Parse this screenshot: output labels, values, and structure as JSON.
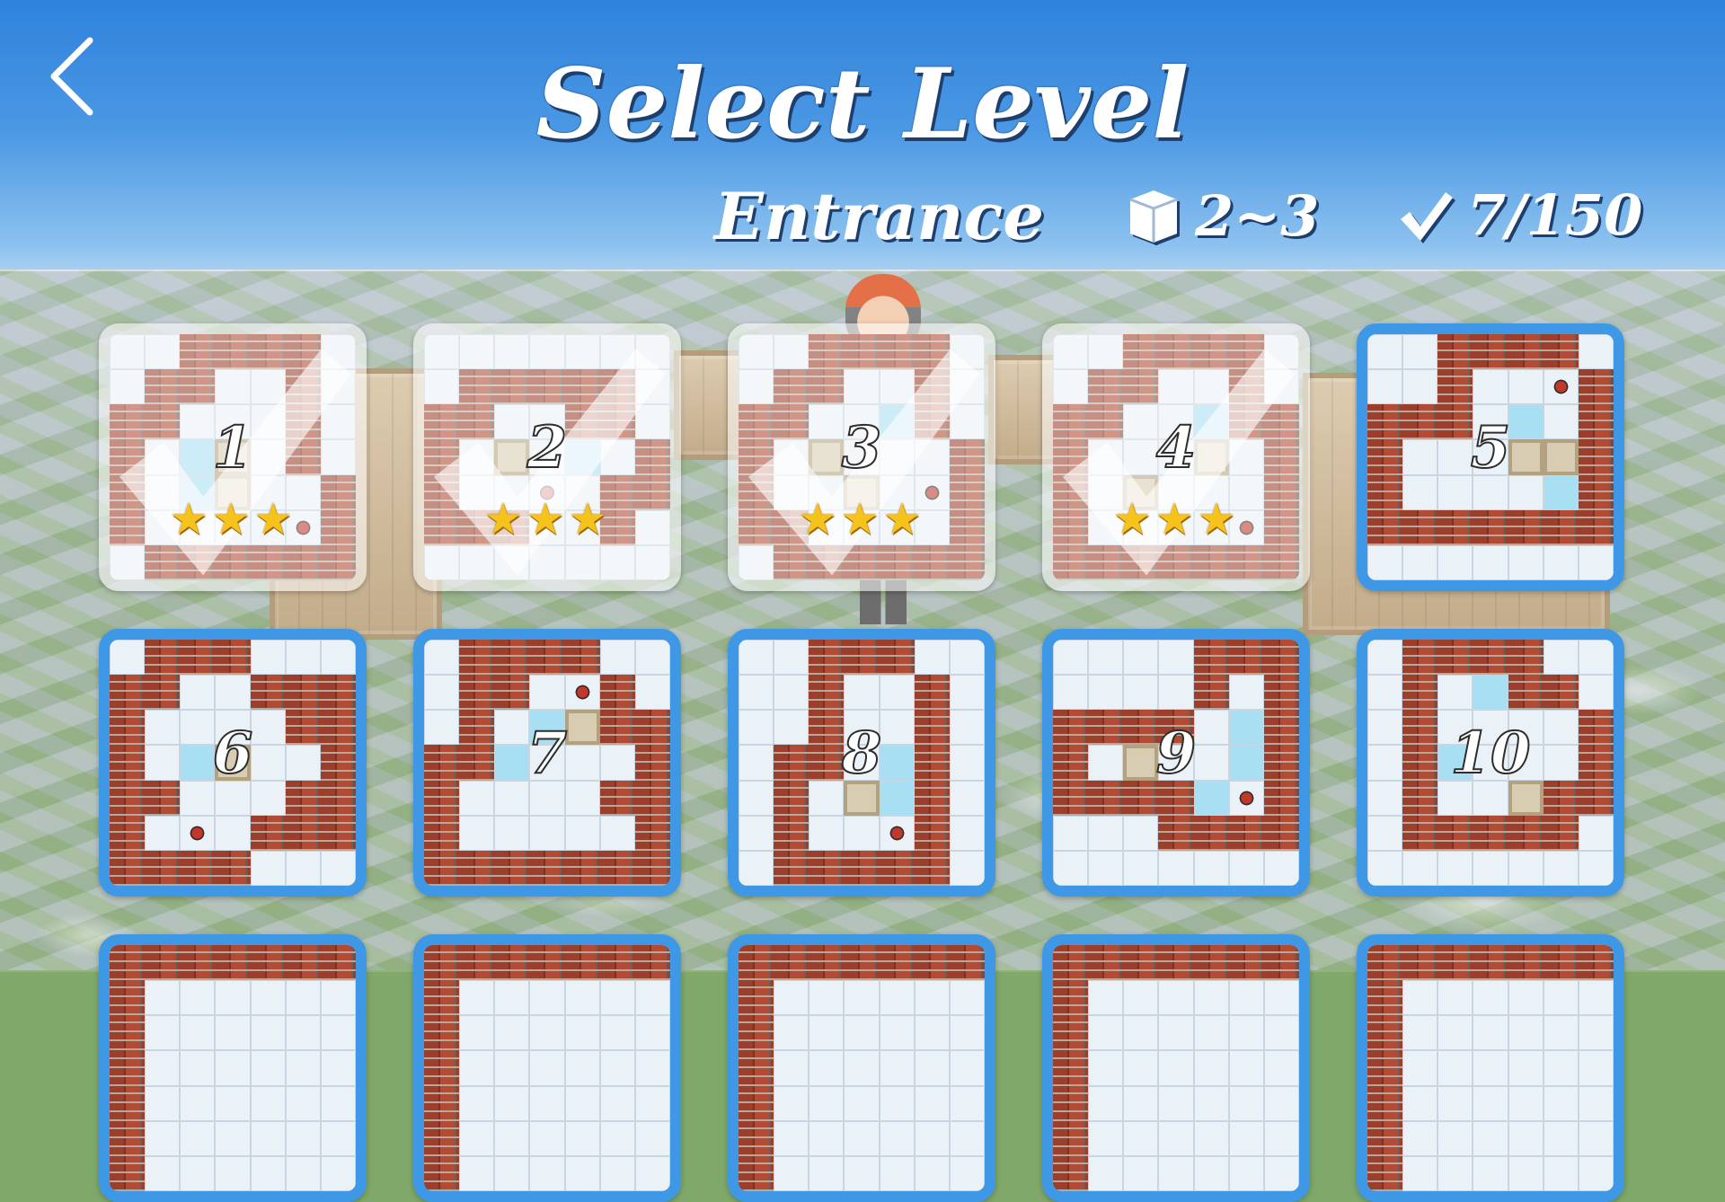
{
  "screen": {
    "title": "Select Level",
    "world_name": "Entrance",
    "box_range": "2~3",
    "progress": "7/150",
    "progress_completed": 7,
    "progress_total": 150
  },
  "icons": {
    "back": "chevron-left-icon",
    "box": "box-icon",
    "check": "checkmark-icon",
    "star": "star-icon"
  },
  "colors": {
    "tile_border": "#3f98e6",
    "title_shadow": "#1d3f6e",
    "star": "#f6c21c"
  },
  "levels": [
    {
      "number": "1",
      "completed": true,
      "stars": 3
    },
    {
      "number": "2",
      "completed": true,
      "stars": 3
    },
    {
      "number": "3",
      "completed": true,
      "stars": 3
    },
    {
      "number": "4",
      "completed": true,
      "stars": 3
    },
    {
      "number": "5",
      "completed": false,
      "stars": 0
    },
    {
      "number": "6",
      "completed": false,
      "stars": 0
    },
    {
      "number": "7",
      "completed": false,
      "stars": 0
    },
    {
      "number": "8",
      "completed": false,
      "stars": 0
    },
    {
      "number": "9",
      "completed": false,
      "stars": 0
    },
    {
      "number": "10",
      "completed": false,
      "stars": 0
    },
    {
      "number": "",
      "completed": false,
      "stars": 0
    },
    {
      "number": "",
      "completed": false,
      "stars": 0
    },
    {
      "number": "",
      "completed": false,
      "stars": 0
    },
    {
      "number": "",
      "completed": false,
      "stars": 0
    },
    {
      "number": "",
      "completed": false,
      "stars": 0
    }
  ]
}
